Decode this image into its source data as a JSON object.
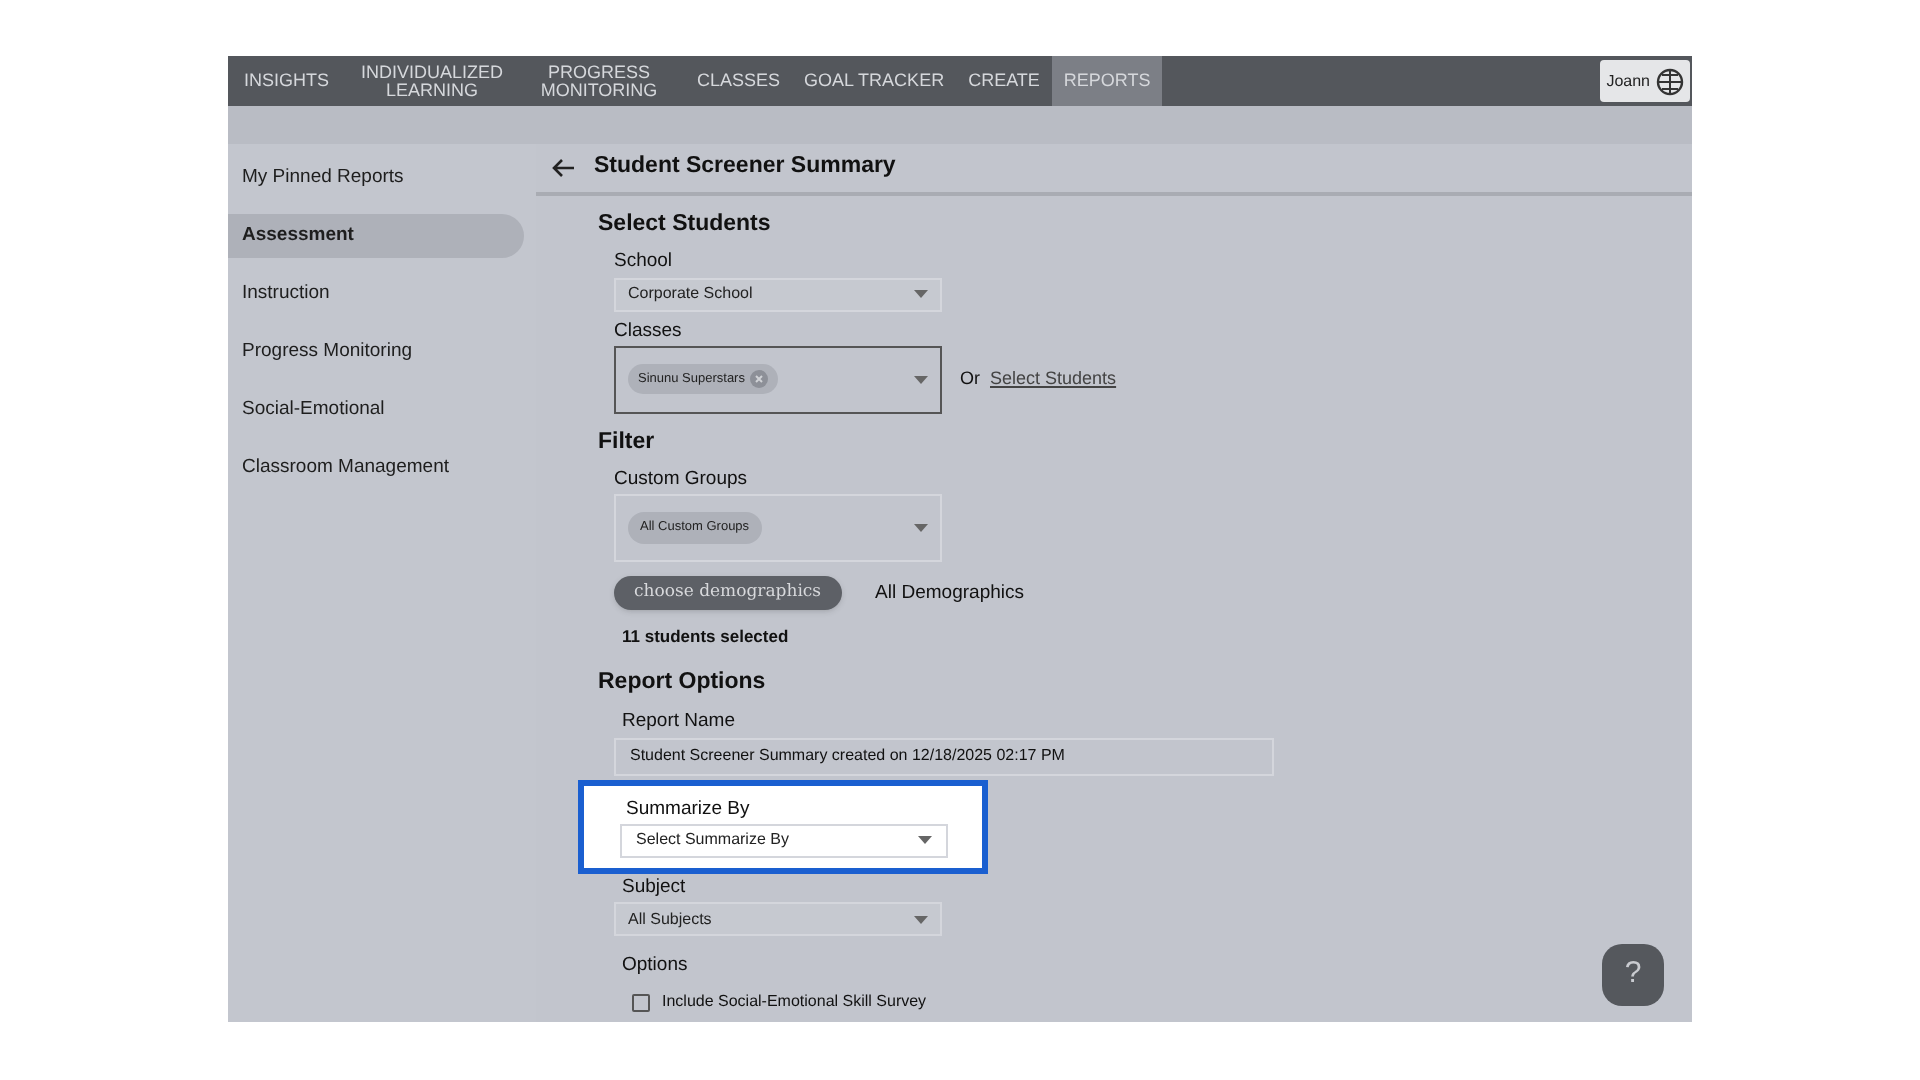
{
  "nav": {
    "tabs": [
      {
        "label": "INSIGHTS",
        "selected": false
      },
      {
        "label": "INDIVIDUALIZED LEARNING",
        "selected": false
      },
      {
        "label": "PROGRESS MONITORING",
        "selected": false
      },
      {
        "label": "CLASSES",
        "selected": false
      },
      {
        "label": "GOAL TRACKER",
        "selected": false
      },
      {
        "label": "CREATE",
        "selected": false
      },
      {
        "label": "REPORTS",
        "selected": true
      }
    ],
    "user": "Joann"
  },
  "sidebar": {
    "items": [
      {
        "label": "My Pinned Reports",
        "selected": false
      },
      {
        "label": "Assessment",
        "selected": true
      },
      {
        "label": "Instruction",
        "selected": false
      },
      {
        "label": "Progress Monitoring",
        "selected": false
      },
      {
        "label": "Social-Emotional",
        "selected": false
      },
      {
        "label": "Classroom Management",
        "selected": false
      }
    ]
  },
  "page": {
    "title": "Student Screener Summary",
    "select_students": {
      "heading": "Select Students",
      "school_label": "School",
      "school_value": "Corporate School",
      "classes_label": "Classes",
      "class_chip": "Sinunu Superstars",
      "or_text": "Or",
      "select_link": "Select Students"
    },
    "filter": {
      "heading": "Filter",
      "groups_label": "Custom Groups",
      "groups_chip": "All Custom Groups",
      "demographics_button": "choose demographics",
      "demographics_value": "All Demographics",
      "selected_count": "11 students selected"
    },
    "report_options": {
      "heading": "Report Options",
      "name_label": "Report Name",
      "name_value": "Student Screener Summary created on 12/18/2025 02:17 PM",
      "summarize_label": "Summarize By",
      "summarize_placeholder": "Select Summarize By",
      "summarize_highlighted": true,
      "subject_label": "Subject",
      "subject_value": "All Subjects",
      "options_label": "Options",
      "options": [
        {
          "label": "Include Social-Emotional Skill Survey",
          "checked": false
        }
      ]
    }
  },
  "help_button": "?"
}
